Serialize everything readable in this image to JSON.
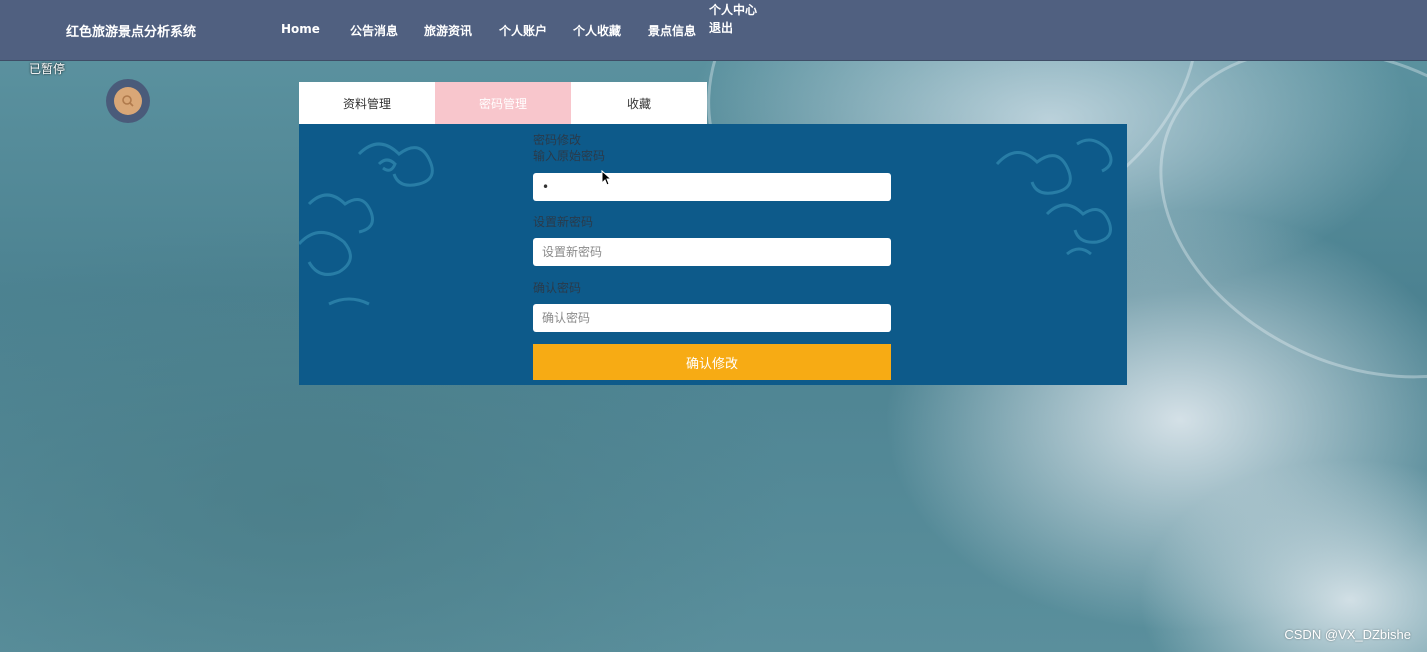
{
  "header": {
    "brand": "红色旅游景点分析系统",
    "nav": [
      {
        "label": "Home"
      },
      {
        "label": "公告消息"
      },
      {
        "label": "旅游资讯"
      },
      {
        "label": "个人账户"
      },
      {
        "label": "个人收藏"
      },
      {
        "label": "景点信息"
      }
    ],
    "nav_stack": [
      "个人中心",
      "退出"
    ]
  },
  "overlay": {
    "paused_label": "已暂停"
  },
  "search": {
    "icon": "search-icon"
  },
  "tabs": [
    {
      "label": "资料管理",
      "active": false
    },
    {
      "label": "密码管理",
      "active": true
    },
    {
      "label": "收藏",
      "active": false
    }
  ],
  "password_form": {
    "title": "密码修改",
    "old_password_label": "输入原始密码",
    "old_password_value": "•",
    "new_password_label": "设置新密码",
    "new_password_placeholder": "设置新密码",
    "confirm_label": "确认密码",
    "confirm_placeholder": "确认密码",
    "submit_label": "确认修改"
  },
  "watermark": "CSDN @VX_DZbishe",
  "colors": {
    "topbar": "#506080",
    "panel": "#0d5a8a",
    "tab_active": "#f8c6cc",
    "submit": "#f7ab14"
  }
}
